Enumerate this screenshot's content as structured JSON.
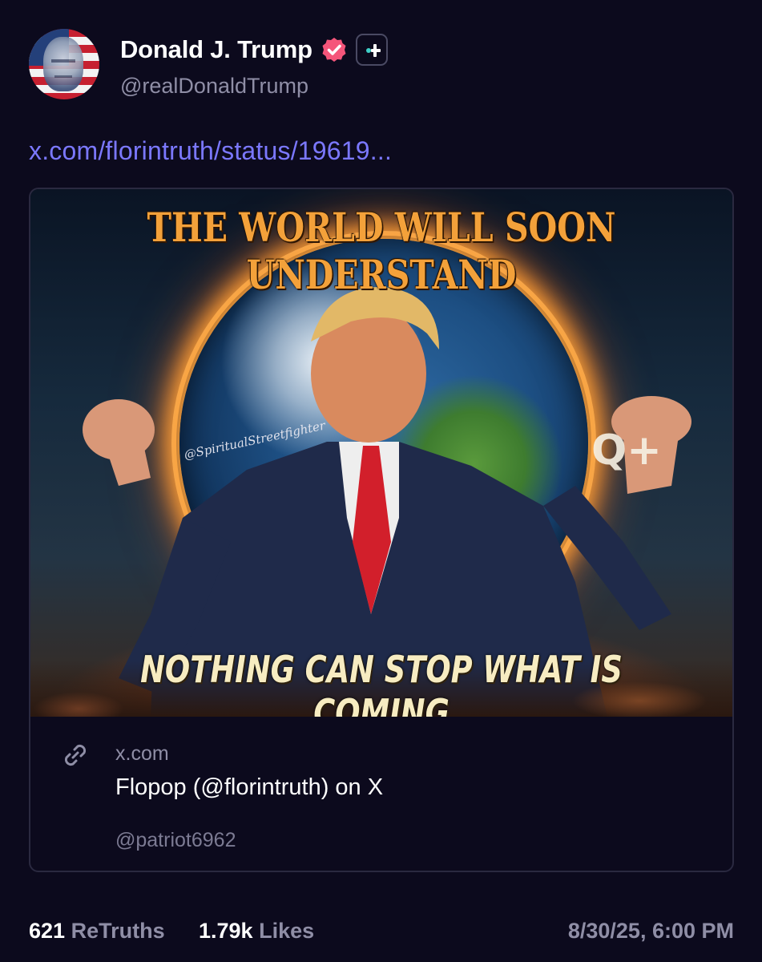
{
  "post": {
    "author": {
      "display_name": "Donald J. Trump",
      "handle": "@realDonaldTrump",
      "verified_icon": "verified-badge-icon",
      "verified_color": "#f5557a",
      "extra_badge_icon": "plus-badge-icon"
    },
    "link_text": "x.com/florintruth/status/19619...",
    "link_color": "#7b78ff",
    "card": {
      "image": {
        "top_caption": "THE WORLD WILL SOON UNDERSTAND",
        "bottom_caption": "NOTHING CAN STOP WHAT IS COMING",
        "watermark": "@SpiritualStreetfighter",
        "mark": "Q+"
      },
      "link_icon": "link-icon",
      "domain": "x.com",
      "title": "Flopop (@florintruth) on X",
      "author": "@patriot6962"
    },
    "stats": {
      "retruths_count": "621",
      "retruths_label": "ReTruths",
      "likes_count": "1.79k",
      "likes_label": "Likes",
      "timestamp": "8/30/25, 6:00 PM"
    }
  },
  "colors": {
    "background": "#0c0a1d",
    "muted_text": "#8f8ea6",
    "card_border": "#2a2940"
  }
}
